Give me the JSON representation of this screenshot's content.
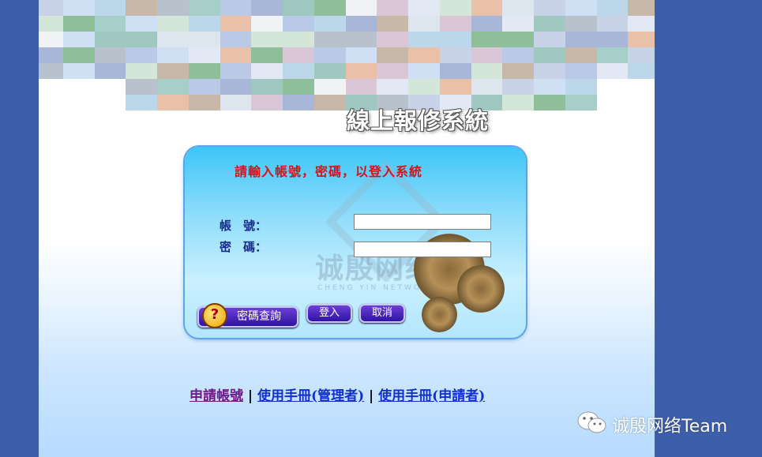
{
  "system_title": "線上報修系統",
  "login_panel": {
    "prompt": "請輸入帳號，密碼，以登入系統",
    "username_label": "帳　號：",
    "password_label": "密　碼：",
    "username_value": "",
    "password_value": "",
    "watermark_text": "诚殷网络",
    "watermark_sub": "CHENG YIN NETWORK",
    "buttons": {
      "query": "密碼查詢",
      "login": "登入",
      "cancel": "取消"
    }
  },
  "footer_links": {
    "apply": "申請帳號",
    "separator": "|",
    "manual_admin": "使用手冊(管理者)",
    "manual_applicant": "使用手冊(申請者)"
  },
  "watermark_brand": "诚殷网络Team",
  "colors": {
    "outer_bg": "#3d5ea8",
    "prompt_red": "#d8121a",
    "label_blue": "#1a2a8c",
    "button_purple": "#4a28bd"
  }
}
